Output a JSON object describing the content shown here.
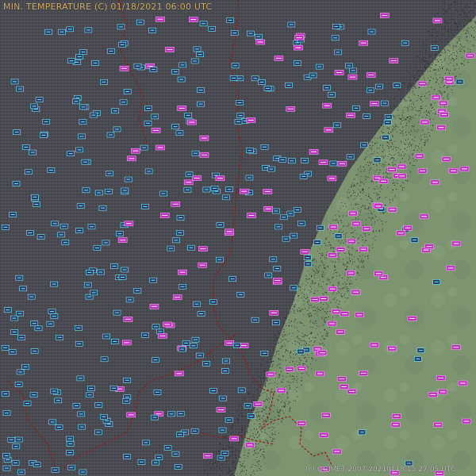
{
  "map": {
    "title": "MIN. TEMPERATURE (C)  01/18/2021 06:00 UTC",
    "credit": "(c) OGIMET 2007 20210118 15:27:05 UTC",
    "colors": {
      "night": "#4a4a52",
      "day": "#7e9672",
      "cold_label_text": "#6ff2ff",
      "cold_label_box": "#2b3a66",
      "warm_label_box": "#c02cc0",
      "warm_label_text": "#ffffff",
      "border": "#a0201e"
    },
    "layers": [
      "night-shading",
      "daylight-terminator",
      "country-borders",
      "station-labels"
    ]
  }
}
